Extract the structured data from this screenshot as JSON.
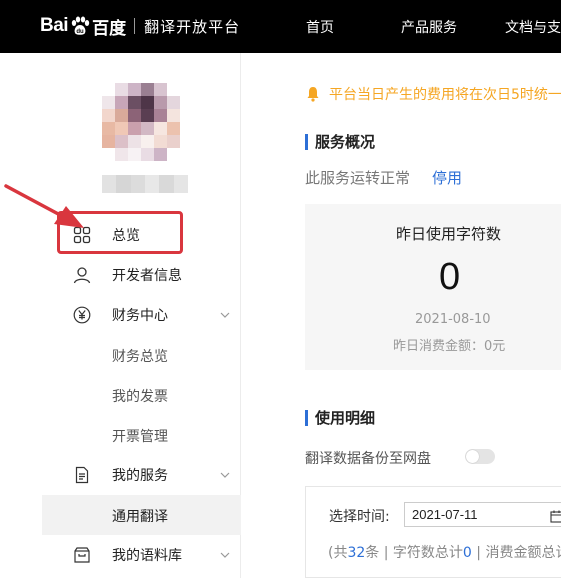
{
  "header": {
    "logo_text_left": "Bai",
    "logo_text_right": "百度",
    "product": "翻译开放平台",
    "nav": [
      "首页",
      "产品服务",
      "文档与支"
    ]
  },
  "sidebar": {
    "menu": {
      "overview": "总览",
      "developer_info": "开发者信息",
      "finance_center": "财务中心",
      "finance_overview": "财务总览",
      "my_invoices": "我的发票",
      "invoice_management": "开票管理",
      "my_services": "我的服务",
      "general_translation": "通用翻译",
      "my_corpus": "我的语料库"
    }
  },
  "main": {
    "notice": "平台当日产生的费用将在次日5时统一",
    "service_overview_title": "服务概况",
    "service_status": "此服务运转正常",
    "stop_label": "停用",
    "card": {
      "title": "昨日使用字符数",
      "value": "0",
      "date": "2021-08-10",
      "fee": "昨日消费金额：0元"
    },
    "usage_title": "使用明细",
    "backup_label": "翻译数据备份至网盘",
    "time_label": "选择时间:",
    "date_value": "2021-07-11",
    "summary_prefix": "(共",
    "summary_count": "32",
    "summary_mid": "条 | 字符数总计",
    "summary_chars": "0",
    "summary_suffix": " | 消费金额总计"
  },
  "colors": {
    "topbar": "#000000",
    "accent_blue": "#2d6fd6",
    "notice_orange": "#f5a623",
    "highlight_red": "#d9363e"
  }
}
